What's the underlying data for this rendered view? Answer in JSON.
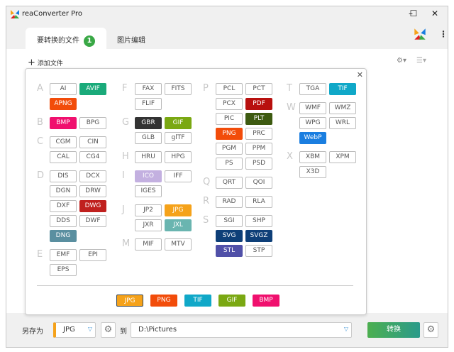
{
  "app": {
    "title": "reaConverter Pro"
  },
  "tabs": [
    {
      "label": "要转换的文件",
      "badge": "1"
    },
    {
      "label": "图片编辑"
    }
  ],
  "toolbar": {
    "add_files": "添加文件"
  },
  "columns": [
    [
      {
        "letter": "A",
        "rows": [
          [
            "AI",
            "AVIF"
          ],
          [
            "APNG"
          ]
        ]
      },
      {
        "letter": "B",
        "rows": [
          [
            "BMP",
            "BPG"
          ]
        ]
      },
      {
        "letter": "C",
        "rows": [
          [
            "CGM",
            "CIN"
          ],
          [
            "CAL",
            "CG4"
          ]
        ]
      },
      {
        "letter": "D",
        "rows": [
          [
            "DIS",
            "DCX"
          ],
          [
            "DGN",
            "DRW"
          ],
          [
            "DXF",
            "DWG"
          ],
          [
            "DDS",
            "DWF"
          ],
          [
            "DNG"
          ]
        ]
      },
      {
        "letter": "E",
        "rows": [
          [
            "EMF",
            "EPI"
          ],
          [
            "EPS"
          ]
        ]
      }
    ],
    [
      {
        "letter": "F",
        "rows": [
          [
            "FAX",
            "FITS"
          ],
          [
            "FLIF"
          ]
        ]
      },
      {
        "letter": "G",
        "rows": [
          [
            "GBR",
            "GIF"
          ],
          [
            "GLB",
            "glTF"
          ]
        ]
      },
      {
        "letter": "H",
        "rows": [
          [
            "HRU",
            "HPG"
          ]
        ]
      },
      {
        "letter": "I",
        "rows": [
          [
            "ICO",
            "IFF"
          ],
          [
            "IGES"
          ]
        ]
      },
      {
        "letter": "J",
        "rows": [
          [
            "JP2",
            "JPG"
          ],
          [
            "JXR",
            "JXL"
          ]
        ]
      },
      {
        "letter": "M",
        "rows": [
          [
            "MIF",
            "MTV"
          ]
        ]
      }
    ],
    [
      {
        "letter": "P",
        "rows": [
          [
            "PCL",
            "PCT"
          ],
          [
            "PCX",
            "PDF"
          ],
          [
            "PIC",
            "PLT"
          ],
          [
            "PNG",
            "PRC"
          ],
          [
            "PGM",
            "PPM"
          ],
          [
            "PS",
            "PSD"
          ]
        ]
      },
      {
        "letter": "Q",
        "rows": [
          [
            "QRT",
            "QOI"
          ]
        ]
      },
      {
        "letter": "R",
        "rows": [
          [
            "RAD",
            "RLA"
          ]
        ]
      },
      {
        "letter": "S",
        "rows": [
          [
            "SGI",
            "SHP"
          ],
          [
            "SVG",
            "SVGZ"
          ],
          [
            "STL",
            "STP"
          ]
        ]
      }
    ],
    [
      {
        "letter": "T",
        "rows": [
          [
            "TGA",
            "TIF"
          ]
        ]
      },
      {
        "letter": "W",
        "rows": [
          [
            "WMF",
            "WMZ"
          ],
          [
            "WPG",
            "WRL"
          ],
          [
            "WebP"
          ]
        ]
      },
      {
        "letter": "X",
        "rows": [
          [
            "XBM",
            "XPM"
          ],
          [
            "X3D"
          ]
        ]
      }
    ]
  ],
  "colors": {
    "AVIF": "#1aaa7a",
    "APNG": "#f24c0a",
    "BMP": "#f0106e",
    "DWG": "#c0201e",
    "DNG": "#5a8fa0",
    "GBR": "#333333",
    "GIF": "#7aa812",
    "ICO": "#c3b0e0",
    "JPG": "#f5a21a",
    "JXL": "#6ab5b0",
    "PDF": "#b8100e",
    "PLT": "#3d5a10",
    "PNG": "#f24c0a",
    "SVG": "#0e3f78",
    "SVGZ": "#0e3f78",
    "STL": "#5050a8",
    "TIF": "#10a8c8",
    "WebP": "#1a7ee0"
  },
  "quick": [
    "JPG",
    "PNG",
    "TIF",
    "GIF",
    "BMP"
  ],
  "bottom": {
    "save_as": "另存为",
    "format": "JPG",
    "to": "到",
    "path": "D:\\Pictures",
    "convert": "转换"
  }
}
